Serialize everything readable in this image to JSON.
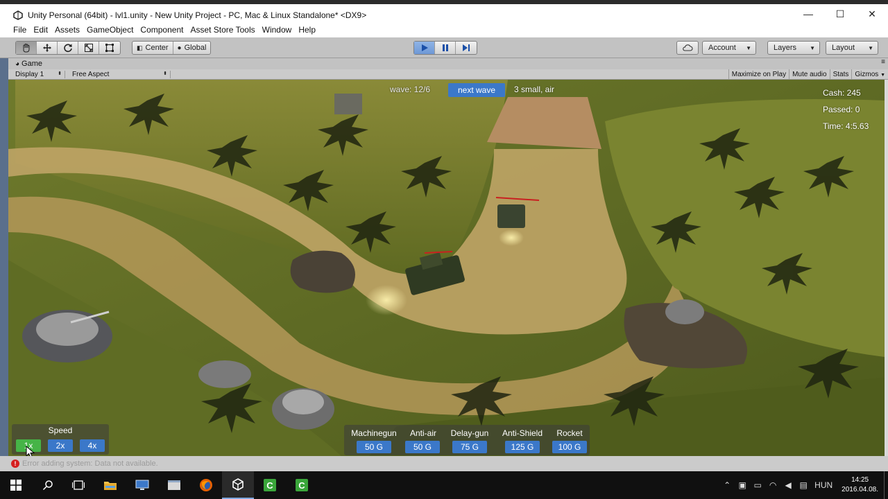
{
  "window": {
    "title": "Unity Personal (64bit) - lvl1.unity - New Unity Project - PC, Mac & Linux Standalone* <DX9>",
    "controls": {
      "minimize": "—",
      "maximize": "☐",
      "close": "✕"
    }
  },
  "menu": [
    "File",
    "Edit",
    "Assets",
    "GameObject",
    "Component",
    "Asset Store Tools",
    "Window",
    "Help"
  ],
  "toolbar": {
    "pivot_center": "Center",
    "pivot_global": "Global",
    "account": "Account",
    "layers": "Layers",
    "layout": "Layout"
  },
  "game_panel": {
    "tab": "Game",
    "display": "Display 1",
    "aspect": "Free Aspect",
    "options": [
      "Maximize on Play",
      "Mute audio",
      "Stats",
      "Gizmos"
    ]
  },
  "hud": {
    "wave": "wave: 12/6",
    "next_wave": "next wave",
    "wave_info": "3 small, air",
    "cash": "Cash: 245",
    "passed": "Passed: 0",
    "time": "Time: 4:5.63"
  },
  "speed": {
    "title": "Speed",
    "options": [
      "1x",
      "2x",
      "4x"
    ],
    "selected": "1x"
  },
  "shop": [
    {
      "name": "Machinegun",
      "price": "50 G"
    },
    {
      "name": "Anti-air",
      "price": "50 G"
    },
    {
      "name": "Delay-gun",
      "price": "75 G"
    },
    {
      "name": "Anti-Shield",
      "price": "125 G"
    },
    {
      "name": "Rocket",
      "price": "100 G"
    }
  ],
  "status": {
    "error": "Error adding system: Data not available."
  },
  "taskbar": {
    "language": "HUN",
    "time": "14:25",
    "date": "2016.04.08."
  },
  "colors": {
    "hud_button": "#3b78c9",
    "selected_speed": "#46b447",
    "editor_gray": "#c2c2c2",
    "play_active": "#6e98d6"
  }
}
